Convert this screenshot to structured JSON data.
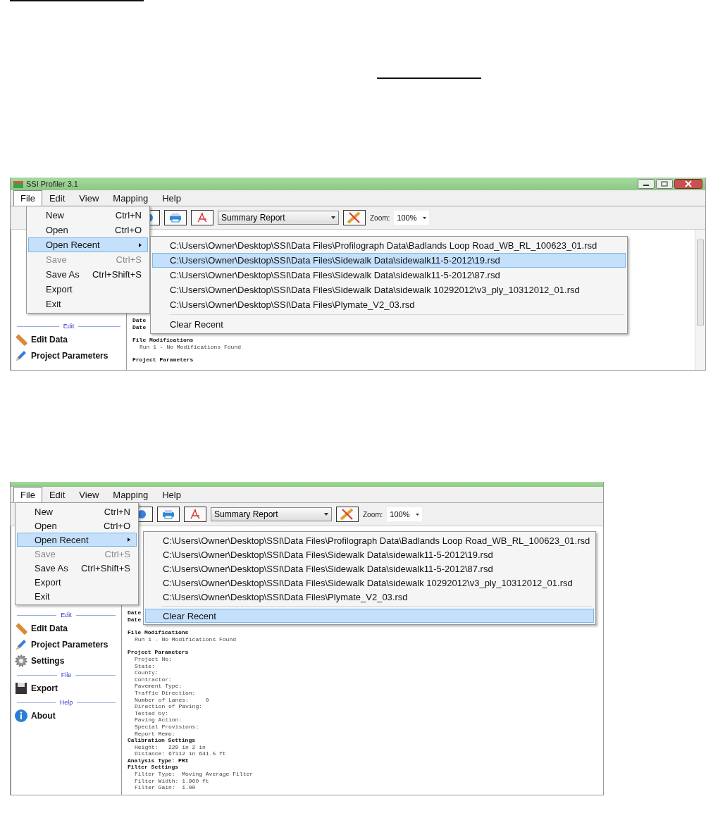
{
  "screenshots": [
    {
      "title": "SSI Profiler 3.1",
      "menus": [
        {
          "label": "File",
          "selected": true
        },
        {
          "label": "Edit",
          "selected": false
        },
        {
          "label": "View",
          "selected": false
        },
        {
          "label": "Mapping",
          "selected": false
        },
        {
          "label": "Help",
          "selected": false
        }
      ],
      "file_menu": [
        {
          "label": "New",
          "shortcut": "Ctrl+N",
          "selected": false,
          "disabled": false,
          "has_submenu": false
        },
        {
          "label": "Open",
          "shortcut": "Ctrl+O",
          "selected": false,
          "disabled": false,
          "has_submenu": false
        },
        {
          "label": "Open Recent",
          "selected": true,
          "disabled": false,
          "has_submenu": true
        },
        {
          "label": "Save",
          "shortcut": "Ctrl+S",
          "selected": false,
          "disabled": true,
          "has_submenu": false
        },
        {
          "label": "Save As",
          "shortcut": "Ctrl+Shift+S",
          "selected": false,
          "disabled": false,
          "has_submenu": false
        },
        {
          "label": "Export",
          "selected": false,
          "disabled": false,
          "has_submenu": false
        },
        {
          "label": "Exit",
          "selected": false,
          "disabled": false,
          "has_submenu": false
        }
      ],
      "recent": [
        {
          "path": "C:\\Users\\Owner\\Desktop\\SSI\\Data Files\\Profilograph Data\\Badlands Loop Road_WB_RL_100623_01.rsd",
          "selected": false
        },
        {
          "path": "C:\\Users\\Owner\\Desktop\\SSI\\Data Files\\Sidewalk Data\\sidewalk11-5-2012\\19.rsd",
          "selected": true
        },
        {
          "path": "C:\\Users\\Owner\\Desktop\\SSI\\Data Files\\Sidewalk Data\\sidewalk11-5-2012\\87.rsd",
          "selected": false
        },
        {
          "path": "C:\\Users\\Owner\\Desktop\\SSI\\Data Files\\Sidewalk Data\\sidewalk 10292012\\v3_ply_10312012_01.rsd",
          "selected": false
        },
        {
          "path": "C:\\Users\\Owner\\Desktop\\SSI\\Data Files\\Plymate_V2_03.rsd",
          "selected": false
        }
      ],
      "clear_recent": {
        "label": "Clear Recent",
        "selected": false
      },
      "toolbar": {
        "report": "Summary Report",
        "zoom_label": "Zoom:",
        "zoom": "100%"
      },
      "sidebar": [
        {
          "title": "Edit",
          "items": [
            "Edit Data",
            "Project Parameters"
          ]
        }
      ],
      "report": [
        {
          "text": "Date",
          "kind": "plain"
        },
        {
          "text": "Date",
          "kind": "plain"
        },
        {
          "text": "File Modifications",
          "kind": "heading"
        },
        {
          "text": "Run 1 - No Modifications Found",
          "kind": "item"
        },
        {
          "text": "Project Parameters",
          "kind": "heading"
        }
      ]
    },
    {
      "menus": [
        {
          "label": "File",
          "selected": true
        },
        {
          "label": "Edit",
          "selected": false
        },
        {
          "label": "View",
          "selected": false
        },
        {
          "label": "Mapping",
          "selected": false
        },
        {
          "label": "Help",
          "selected": false
        }
      ],
      "file_menu": [
        {
          "label": "New",
          "shortcut": "Ctrl+N",
          "selected": false,
          "disabled": false,
          "has_submenu": false
        },
        {
          "label": "Open",
          "shortcut": "Ctrl+O",
          "selected": false,
          "disabled": false,
          "has_submenu": false
        },
        {
          "label": "Open Recent",
          "selected": true,
          "disabled": false,
          "has_submenu": true
        },
        {
          "label": "Save",
          "shortcut": "Ctrl+S",
          "selected": false,
          "disabled": true,
          "has_submenu": false
        },
        {
          "label": "Save As",
          "shortcut": "Ctrl+Shift+S",
          "selected": false,
          "disabled": false,
          "has_submenu": false
        },
        {
          "label": "Export",
          "selected": false,
          "disabled": false,
          "has_submenu": false
        },
        {
          "label": "Exit",
          "selected": false,
          "disabled": false,
          "has_submenu": false
        }
      ],
      "recent": [
        {
          "path": "C:\\Users\\Owner\\Desktop\\SSI\\Data Files\\Profilograph Data\\Badlands Loop Road_WB_RL_100623_01.rsd",
          "selected": false
        },
        {
          "path": "C:\\Users\\Owner\\Desktop\\SSI\\Data Files\\Sidewalk Data\\sidewalk11-5-2012\\19.rsd",
          "selected": false
        },
        {
          "path": "C:\\Users\\Owner\\Desktop\\SSI\\Data Files\\Sidewalk Data\\sidewalk11-5-2012\\87.rsd",
          "selected": false
        },
        {
          "path": "C:\\Users\\Owner\\Desktop\\SSI\\Data Files\\Sidewalk Data\\sidewalk 10292012\\v3_ply_10312012_01.rsd",
          "selected": false
        },
        {
          "path": "C:\\Users\\Owner\\Desktop\\SSI\\Data Files\\Plymate_V2_03.rsd",
          "selected": false
        }
      ],
      "clear_recent": {
        "label": "Clear Recent",
        "selected": true
      },
      "toolbar": {
        "report": "Summary Report",
        "zoom_label": "Zoom:",
        "zoom": "100%"
      },
      "sidebar": [
        {
          "title": "Edit",
          "items": [
            "Edit Data",
            "Project Parameters",
            "Settings"
          ]
        },
        {
          "title": "File",
          "items": [
            "Export"
          ]
        },
        {
          "title": "Help",
          "items": [
            "About"
          ]
        }
      ],
      "report": [
        {
          "text": "Date",
          "kind": "plain"
        },
        {
          "text": "Date",
          "kind": "plain"
        },
        {
          "text": "File Modifications",
          "kind": "heading"
        },
        {
          "text": "Run 1 - No Modifications Found",
          "kind": "item"
        },
        {
          "text": "Project Parameters",
          "kind": "heading"
        },
        {
          "text": "Project No:",
          "kind": "item"
        },
        {
          "text": "State:",
          "kind": "item"
        },
        {
          "text": "County:",
          "kind": "item"
        },
        {
          "text": "Contractor:",
          "kind": "item"
        },
        {
          "text": "Pavement Type:",
          "kind": "item"
        },
        {
          "text": "Traffic Direction:",
          "kind": "item"
        },
        {
          "text": "Number of Lanes:     0",
          "kind": "item"
        },
        {
          "text": "Direction of Paving:",
          "kind": "item"
        },
        {
          "text": "Tested by:",
          "kind": "item"
        },
        {
          "text": "Paving Action:",
          "kind": "item"
        },
        {
          "text": "Special Provisions:",
          "kind": "item"
        },
        {
          "text": "Report Memo:",
          "kind": "item"
        },
        {
          "text": "Calibration Settings",
          "kind": "section"
        },
        {
          "text": "Height:   229 in 2 in",
          "kind": "item"
        },
        {
          "text": "Distance: 67112 in 641.5 ft",
          "kind": "item"
        },
        {
          "text": "Analysis Type: PRI",
          "kind": "section"
        },
        {
          "text": "Filter Settings",
          "kind": "section"
        },
        {
          "text": "Filter Type:  Moving Average Filter",
          "kind": "item"
        },
        {
          "text": "Filter Width: 1.900 ft",
          "kind": "item"
        },
        {
          "text": "Filter Gain:  1.00",
          "kind": "item"
        }
      ]
    }
  ]
}
